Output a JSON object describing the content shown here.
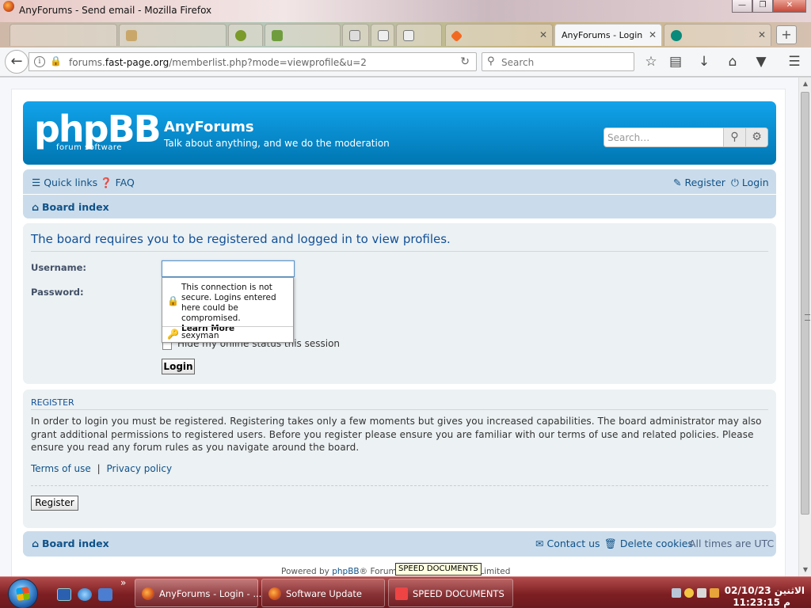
{
  "window": {
    "title": "AnyForums - Send email - Mozilla Firefox",
    "controls": {
      "minimize": "—",
      "maximize": "❐",
      "close": "✕"
    }
  },
  "tabs": [
    {
      "label": ""
    },
    {
      "label": ""
    },
    {
      "label": ""
    },
    {
      "label": ""
    },
    {
      "label": ""
    },
    {
      "label": ""
    },
    {
      "label": ""
    },
    {
      "label": "AnyForums - Login",
      "close": "✕"
    },
    {
      "label": "",
      "close": "✕"
    }
  ],
  "navbar": {
    "url_prefix": "forums.",
    "url_domain": "fast-page.org",
    "url_path": "/memberlist.php?mode=viewprofile&u=2",
    "search_placeholder": "Search"
  },
  "forum": {
    "logo_text": "phpBB",
    "logo_subtext": "forum   software",
    "site_name": "AnyForums",
    "site_description": "Talk about anything, and we do the moderation",
    "search_placeholder": "Search…",
    "quick_links": "Quick links",
    "faq": "FAQ",
    "register": "Register",
    "login": "Login",
    "board_index": "Board index"
  },
  "login_panel": {
    "heading": "The board requires you to be registered and logged in to view profiles.",
    "username_label": "Username:",
    "password_label": "Password:",
    "hide_online_label": "Hide my online status this session",
    "login_button": "Login"
  },
  "autocomplete": {
    "warning": "This connection is not secure. Logins entered here could be compromised.",
    "learn_more": "Learn More",
    "saved_login": "sexyman"
  },
  "register_panel": {
    "heading": "Register",
    "text": "In order to login you must be registered. Registering takes only a few moments but gives you increased capabilities. The board administrator may also grant additional permissions to registered users. Before you register please ensure you are familiar with our terms of use and related policies. Please ensure you read any forum rules as you navigate around the board.",
    "terms": "Terms of use",
    "separator": "|",
    "privacy": "Privacy policy",
    "register_button": "Register"
  },
  "footer": {
    "board_index": "Board index",
    "contact": "Contact us",
    "delete_cookies": "Delete cookies",
    "timezone": "All times are UTC",
    "powered_prefix": "Powered by ",
    "powered_link": "phpBB",
    "powered_rest": "® Forum Software © phpBB Limited"
  },
  "taskbar": {
    "chevron": "»",
    "buttons": [
      {
        "label": "AnyForums - Login - ..."
      },
      {
        "label": "Software Update"
      },
      {
        "label": "SPEED DOCUMENTS"
      }
    ],
    "tooltip": "SPEED DOCUMENTS",
    "clock_day": "الاثنين",
    "clock_date": "02/10/23",
    "clock_time": "11:23:15",
    "clock_period": "م"
  },
  "colors": {
    "header_blue": "#0f8fd3",
    "link_blue": "#105289",
    "nav_panel": "#cadceb",
    "taskbar_red": "#8a2a2d"
  }
}
